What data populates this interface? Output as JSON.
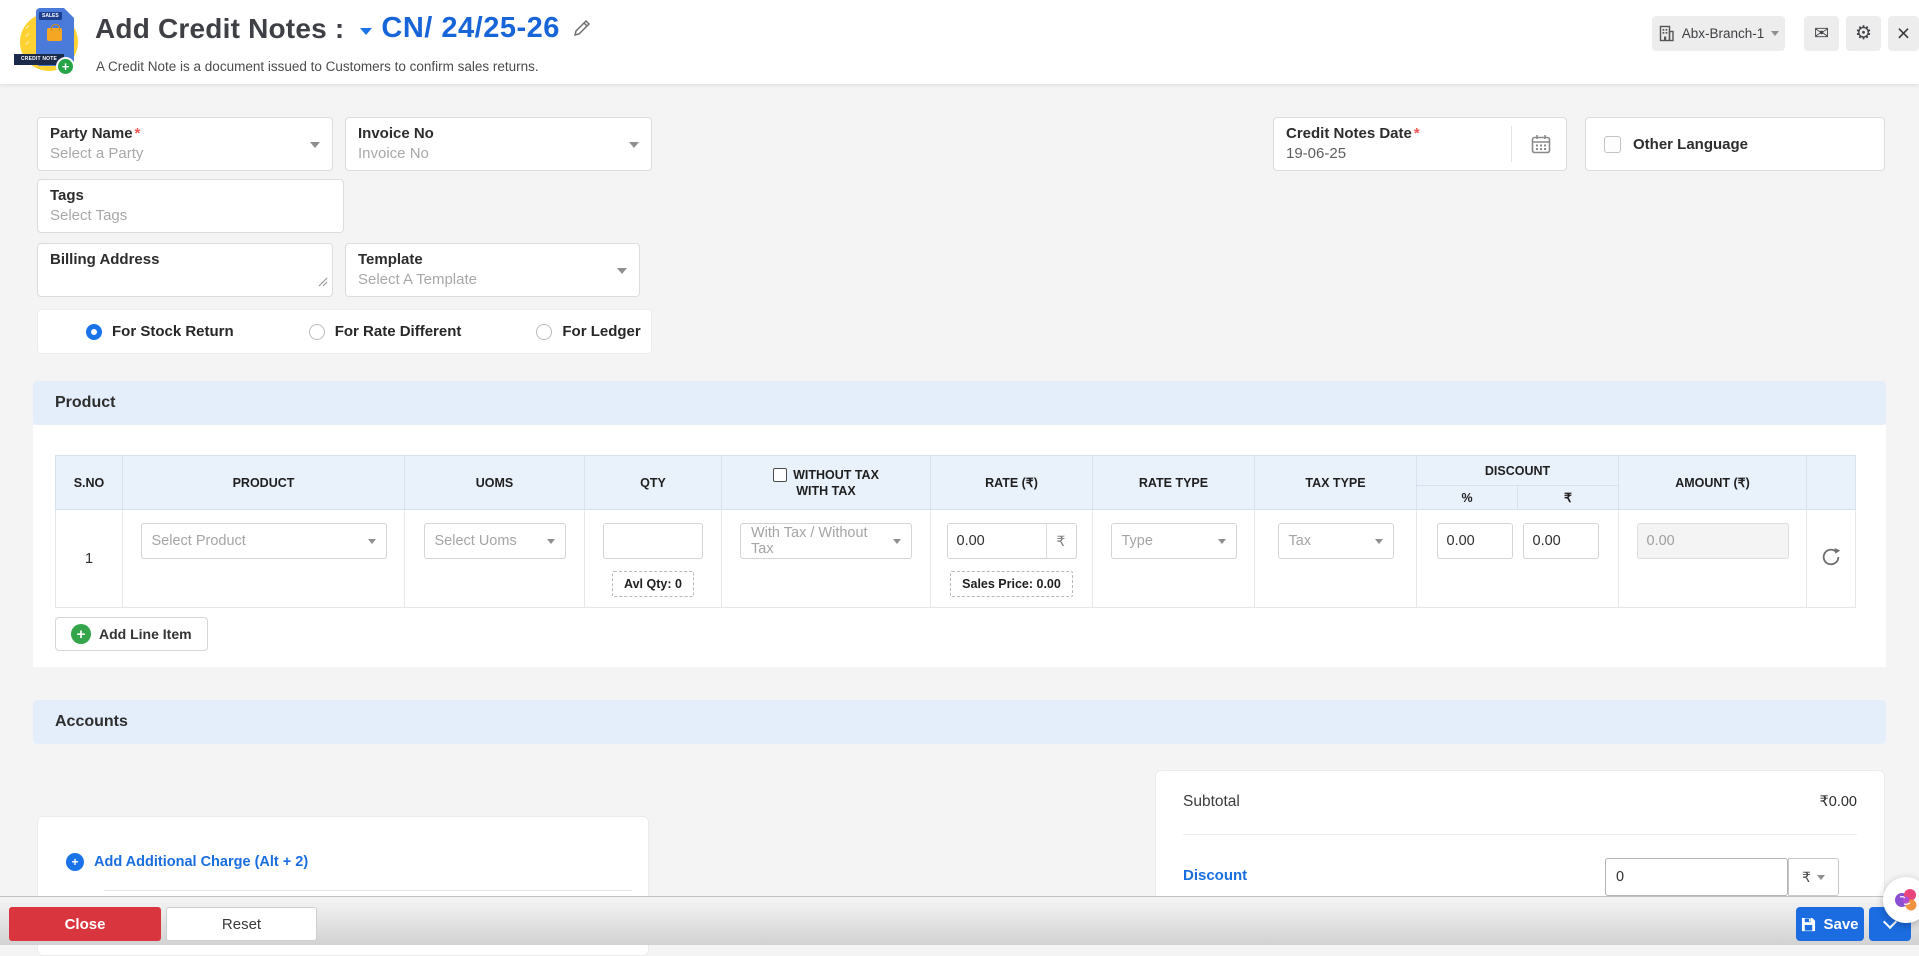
{
  "header": {
    "title": "Add Credit Notes :",
    "doc_number": "CN/ 24/25-26",
    "subtitle": "A Credit Note is a document issued to Customers to confirm sales returns.",
    "branch_name": "Abx-Branch-1",
    "icons": {
      "mail": "✉",
      "settings": "⚙",
      "close": "×"
    }
  },
  "form": {
    "party_name": {
      "label": "Party Name",
      "required": true,
      "placeholder": "Select a Party"
    },
    "invoice_no": {
      "label": "Invoice No",
      "placeholder": "Invoice No"
    },
    "credit_notes_date": {
      "label": "Credit Notes Date",
      "required": true,
      "value": "19-06-25"
    },
    "other_language": {
      "label": "Other Language",
      "checked": false
    },
    "tags": {
      "label": "Tags",
      "placeholder": "Select Tags"
    },
    "billing_address": {
      "label": "Billing Address",
      "value": ""
    },
    "template": {
      "label": "Template",
      "placeholder": "Select A Template"
    },
    "radios": [
      {
        "label": "For Stock Return",
        "selected": true
      },
      {
        "label": "For Rate Different",
        "selected": false
      },
      {
        "label": "For Ledger",
        "selected": false
      }
    ]
  },
  "product_section": {
    "title": "Product",
    "table": {
      "headers": {
        "sno": "S.NO",
        "product": "PRODUCT",
        "uoms": "UOMS",
        "qty": "QTY",
        "without_tax": "WITHOUT TAX",
        "with_tax": "WITH TAX",
        "rate": "RATE (₹)",
        "rate_type": "RATE TYPE",
        "tax_type": "TAX TYPE",
        "discount": "DISCOUNT",
        "discount_pct": "%",
        "discount_rs": "₹",
        "amount": "AMOUNT (₹)"
      },
      "row": {
        "sno": "1",
        "product_placeholder": "Select Product",
        "uoms_placeholder": "Select Uoms",
        "qty_value": "",
        "avl_qty": "Avl Qty: 0",
        "tax_mode_placeholder": "With Tax / Without Tax",
        "rate_value": "0.00",
        "rate_currency": "₹",
        "sales_price": "Sales Price: 0.00",
        "rate_type_placeholder": "Type",
        "tax_type_placeholder": "Tax",
        "discount_percent": "0.00",
        "discount_amount": "0.00",
        "amount": "0.00"
      }
    },
    "add_line_item": "Add Line Item"
  },
  "accounts_section": {
    "title": "Accounts"
  },
  "charges": {
    "add_additional_charge": "Add Additional Charge (Alt + 2)"
  },
  "totals": {
    "subtotal_label": "Subtotal",
    "subtotal_value": "₹0.00",
    "discount_label": "Discount",
    "discount_value": "0",
    "discount_unit": "₹"
  },
  "footer": {
    "close": "Close",
    "reset": "Reset",
    "save": "Save"
  }
}
